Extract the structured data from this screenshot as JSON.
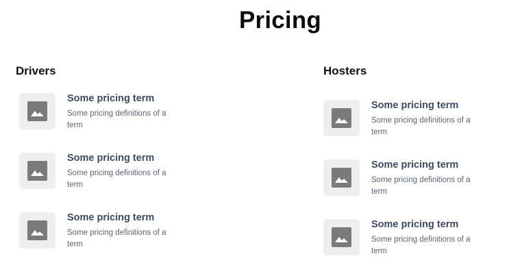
{
  "page": {
    "title": "Pricing"
  },
  "columns": [
    {
      "heading": "Drivers",
      "items": [
        {
          "title": "Some pricing term",
          "description": "Some pricing definitions of a term"
        },
        {
          "title": "Some pricing term",
          "description": "Some pricing definitions of a term"
        },
        {
          "title": "Some pricing term",
          "description": "Some pricing definitions of a term"
        }
      ]
    },
    {
      "heading": "Hosters",
      "items": [
        {
          "title": "Some pricing term",
          "description": "Some pricing definitions of a term"
        },
        {
          "title": "Some pricing term",
          "description": "Some pricing definitions of a term"
        },
        {
          "title": "Some pricing term",
          "description": "Some pricing definitions of a term"
        }
      ]
    }
  ],
  "icons": {
    "item_thumbnail": "image-placeholder-icon"
  },
  "colors": {
    "title_text": "#0d0d0d",
    "item_title": "#3c4a63",
    "item_description": "#5b6476",
    "thumbnail_bg": "#eeeeee",
    "thumbnail_icon": "#7a7a7a"
  }
}
